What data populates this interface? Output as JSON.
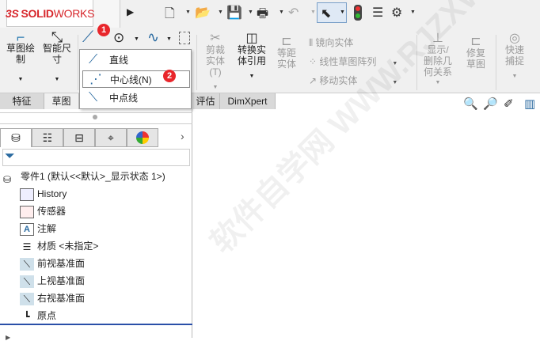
{
  "app": {
    "logo_ds": "3S",
    "logo_solid": "SOLID",
    "logo_works": "WORKS"
  },
  "toolbar": {
    "icons": [
      "new-document-icon",
      "open-icon",
      "save-icon",
      "print-icon",
      "undo-icon",
      "select-icon",
      "rebuild-icon",
      "file-properties-icon",
      "options-icon"
    ]
  },
  "ribbon": {
    "sketch": "草图绘制",
    "smart_dim": "智能尺寸",
    "trim": "剪裁实体(T)",
    "convert": "转换实体引用",
    "offset": "等距实体",
    "mirror": "镜向实体",
    "linear_pattern": "线性草图阵列",
    "move": "移动实体",
    "show_delete": "显示/删除几何关系",
    "repair": "修复草图",
    "quick_snap": "快速捕捉"
  },
  "tabs": [
    {
      "label": "特征"
    },
    {
      "label": "草图"
    },
    {
      "label": "评估"
    },
    {
      "label": "DimXpert"
    }
  ],
  "dropdown": {
    "items": [
      {
        "label": "直线"
      },
      {
        "label": "中心线(N)"
      },
      {
        "label": "中点线"
      }
    ]
  },
  "badges": [
    "1",
    "2"
  ],
  "tree": {
    "root": "零件1 (默认<<默认>_显示状态 1>)",
    "items": [
      {
        "label": "History"
      },
      {
        "label": "传感器"
      },
      {
        "label": "注解"
      },
      {
        "label": "材质 <未指定>"
      },
      {
        "label": "前视基准面"
      },
      {
        "label": "上视基准面"
      },
      {
        "label": "右视基准面"
      },
      {
        "label": "原点"
      }
    ]
  },
  "watermark": "软件自学网 WWW.RJZXW.COM"
}
